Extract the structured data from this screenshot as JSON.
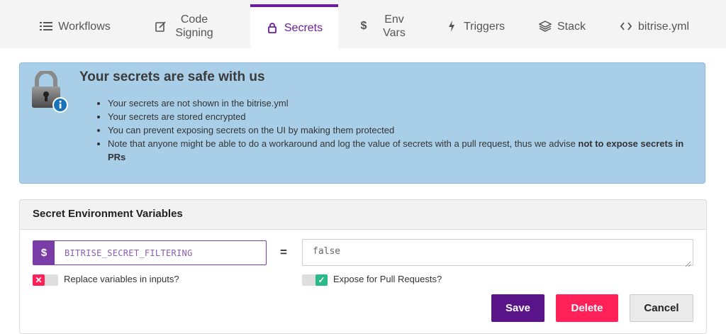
{
  "tabs": [
    {
      "label": "Workflows",
      "icon": "list-icon",
      "active": false
    },
    {
      "label": "Code Signing",
      "icon": "edit-icon",
      "active": false
    },
    {
      "label": "Secrets",
      "icon": "lock-icon",
      "active": true
    },
    {
      "label": "Env Vars",
      "icon": "dollar-icon",
      "active": false
    },
    {
      "label": "Triggers",
      "icon": "bolt-icon",
      "active": false
    },
    {
      "label": "Stack",
      "icon": "layers-icon",
      "active": false
    },
    {
      "label": "bitrise.yml",
      "icon": "code-icon",
      "active": false
    }
  ],
  "info": {
    "title": "Your secrets are safe with us",
    "items": [
      "Your secrets are not shown in the bitrise.yml",
      "Your secrets are stored encrypted",
      "You can prevent exposing secrets on the UI by making them protected"
    ],
    "note_prefix": "Note that anyone might be able to do a workaround and log the value of secrets with a pull request, thus we advise ",
    "note_bold": "not to expose secrets in PRs"
  },
  "panel": {
    "title": "Secret Environment Variables",
    "key_prefix": "$",
    "key_value": "BITRISE_SECRET_FILTERING",
    "equals": "=",
    "value": "false",
    "replace_label": "Replace variables in inputs?",
    "replace_checked": false,
    "expose_label": "Expose for Pull Requests?",
    "expose_checked": true
  },
  "buttons": {
    "save": "Save",
    "delete": "Delete",
    "cancel": "Cancel"
  },
  "colors": {
    "accent": "#6c1d9b",
    "info_bg": "#a9cfe8",
    "delete": "#ff2158",
    "save": "#5a1489",
    "toggle_on": "#2aba8a",
    "toggle_off": "#ff2158"
  }
}
